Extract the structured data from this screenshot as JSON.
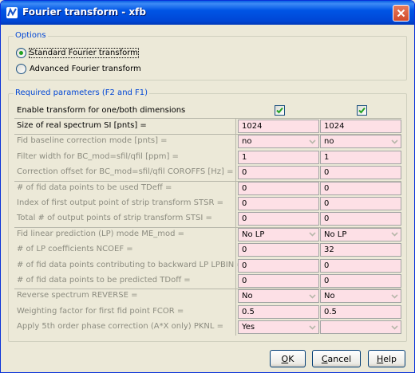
{
  "window": {
    "title": "Fourier transform - xfb"
  },
  "options": {
    "legend": "Options",
    "radios": [
      {
        "label": "Standard Fourier transform",
        "checked": true
      },
      {
        "label": "Advanced Fourier transform",
        "checked": false
      }
    ]
  },
  "params": {
    "legend": "Required parameters (F2 and F1)",
    "enable_label": "Enable transform for one/both dimensions",
    "enable_f2": true,
    "enable_f1": true,
    "rows": [
      {
        "label": "Size of real spectrum SI [pnts] =",
        "disabled": false,
        "type": "text",
        "v1": "1024",
        "v2": "1024"
      },
      {
        "label": "Fid baseline correction mode [pnts] =",
        "disabled": true,
        "type": "combo",
        "v1": "no",
        "v2": "no"
      },
      {
        "label": "Filter width for BC_mod=sfil/qfil [ppm] =",
        "disabled": true,
        "type": "text",
        "v1": "1",
        "v2": "1"
      },
      {
        "label": "Correction offset for BC_mod=sfil/qfil COROFFS [Hz] =",
        "disabled": true,
        "type": "text",
        "v1": "0",
        "v2": "0"
      },
      {
        "label": "# of fid data points to be used TDeff =",
        "disabled": true,
        "type": "text",
        "v1": "0",
        "v2": "0"
      },
      {
        "label": "Index of first output point of strip transform STSR =",
        "disabled": true,
        "type": "text",
        "v1": "0",
        "v2": "0"
      },
      {
        "label": "Total # of output points of strip transform STSI =",
        "disabled": true,
        "type": "text",
        "v1": "0",
        "v2": "0"
      },
      {
        "label": "Fid linear prediction (LP) mode ME_mod =",
        "disabled": true,
        "type": "combo",
        "v1": "No LP",
        "v2": "No LP"
      },
      {
        "label": "# of LP coefficients NCOEF =",
        "disabled": true,
        "type": "text",
        "v1": "0",
        "v2": "32"
      },
      {
        "label": "# of fid data points contributing to backward LP LPBIN =",
        "disabled": true,
        "type": "text",
        "v1": "0",
        "v2": "0"
      },
      {
        "label": "# of fid data points to be predicted TDoff =",
        "disabled": true,
        "type": "text",
        "v1": "0",
        "v2": "0"
      },
      {
        "label": "Reverse spectrum REVERSE =",
        "disabled": true,
        "type": "combo",
        "v1": "No",
        "v2": "No"
      },
      {
        "label": "Weighting factor for first fid point FCOR =",
        "disabled": true,
        "type": "text",
        "v1": "0.5",
        "v2": "0.5"
      },
      {
        "label": "Apply 5th order phase correction (A*X only) PKNL =",
        "disabled": true,
        "type": "combo",
        "v1": "Yes",
        "v2": ""
      }
    ]
  },
  "buttons": {
    "ok": {
      "prefix": "",
      "mnemonic": "O",
      "rest": "K"
    },
    "cancel": {
      "prefix": "",
      "mnemonic": "C",
      "rest": "ancel"
    },
    "help": {
      "prefix": "",
      "mnemonic": "H",
      "rest": "elp"
    }
  }
}
